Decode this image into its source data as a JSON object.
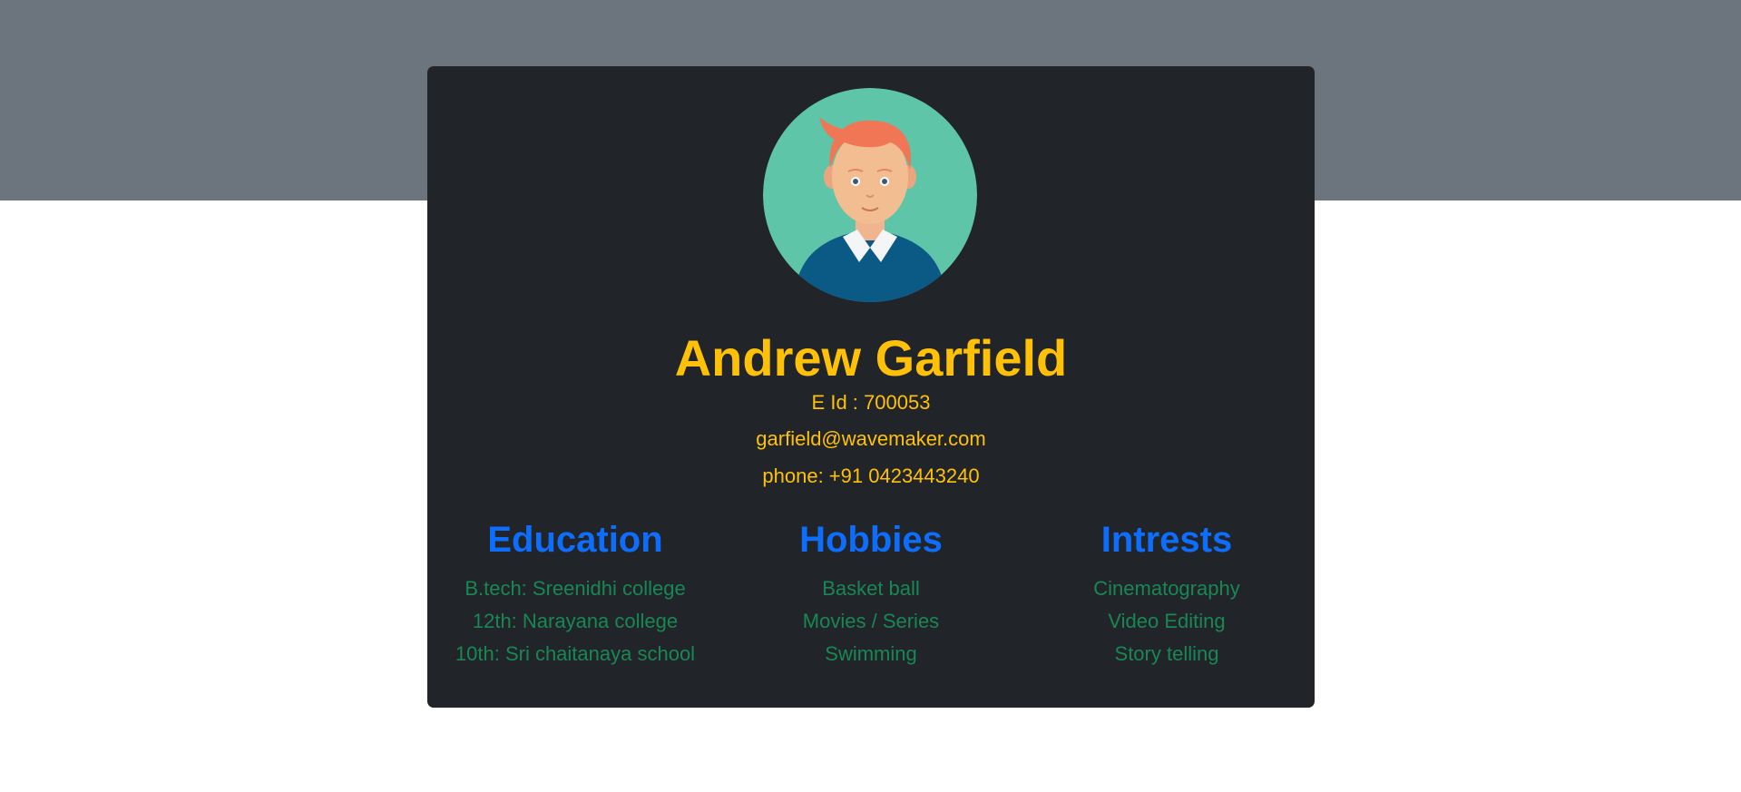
{
  "profile": {
    "name": "Andrew Garfield",
    "eid": "E Id : 700053",
    "email": "garfield@wavemaker.com",
    "phone": "phone: +91 0423443240"
  },
  "sections": {
    "education": {
      "title": "Education",
      "items": [
        "B.tech: Sreenidhi college",
        "12th: Narayana college",
        "10th: Sri chaitanaya school"
      ]
    },
    "hobbies": {
      "title": "Hobbies",
      "items": [
        "Basket ball",
        "Movies / Series",
        "Swimming"
      ]
    },
    "interests": {
      "title": "Intrests",
      "items": [
        "Cinematography",
        "Video Editing",
        "Story telling"
      ]
    }
  },
  "colors": {
    "banner": "#6c757d",
    "card": "#212529",
    "name": "#ffc107",
    "heading": "#0d6efd",
    "item": "#198754"
  },
  "icons": {
    "avatar": "male-avatar-icon"
  }
}
